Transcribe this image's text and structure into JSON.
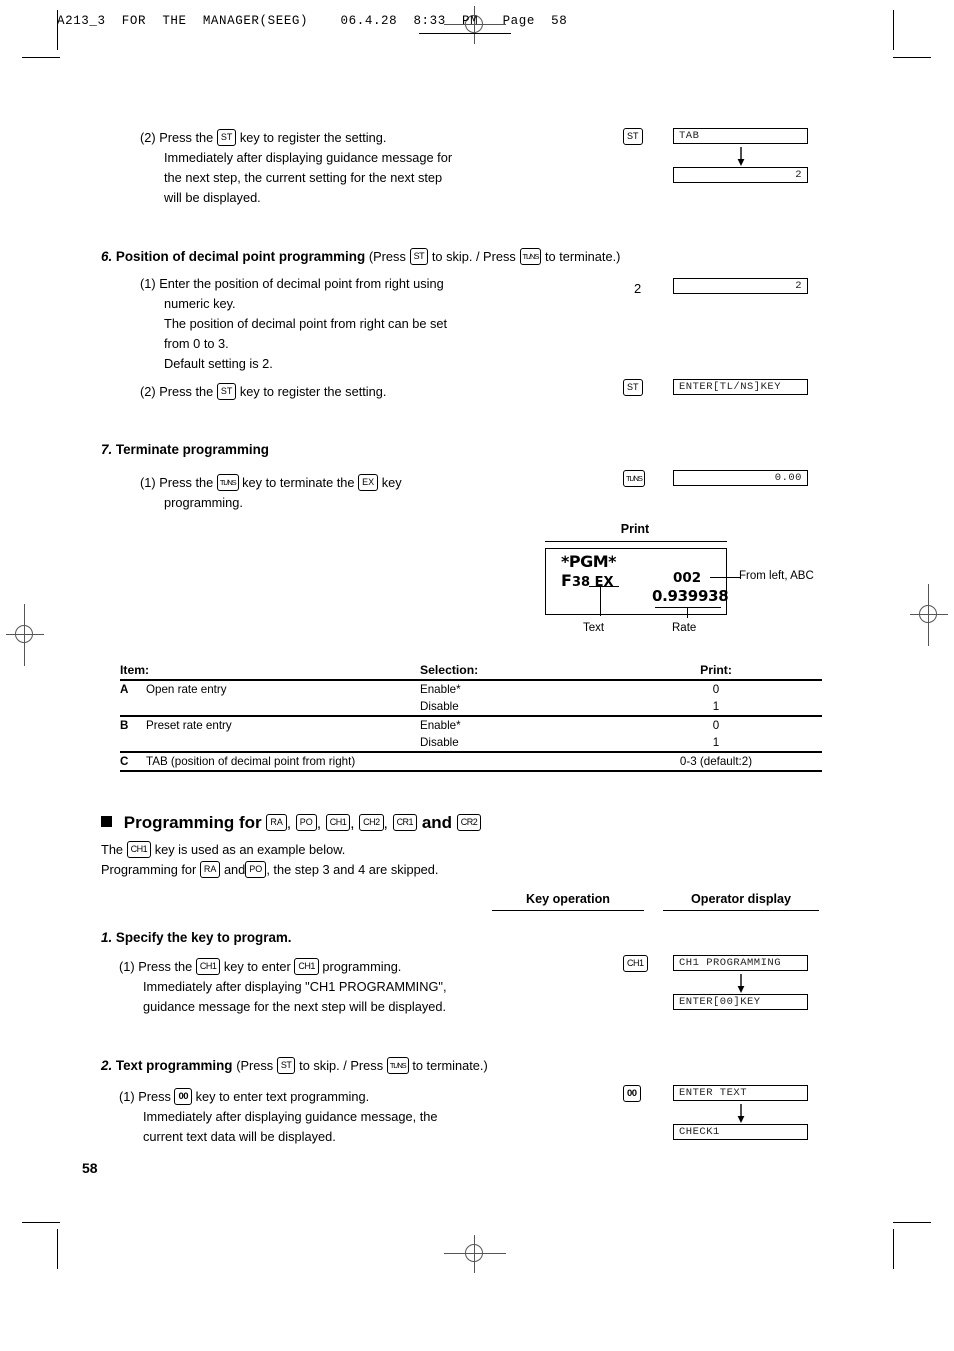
{
  "page": {
    "header_line": "A213_3  FOR  THE  MANAGER(SEEG)    06.4.28  8:33  PM   Page  58",
    "number": "58"
  },
  "step5": {
    "item2_prefix": "(2) Press the",
    "key_st": "ST",
    "item2_mid": "key to register the setting.",
    "item2_l2": "Immediately after displaying guidance message for",
    "item2_l3": "the next step, the current setting for the next step",
    "item2_l4": "will be displayed.",
    "display_1": "TAB",
    "display_2": "2"
  },
  "step6": {
    "num": "6.",
    "title": "Position of decimal point programming",
    "paren_open": "(Press",
    "key_st": "ST",
    "paren_mid": "to skip. / Press",
    "key_tlns": "TL/NS",
    "paren_close": "to terminate.)",
    "item1_l1": "(1) Enter the position of decimal point from right using",
    "item1_l2": "numeric key.",
    "item1_l3": "The position of decimal point from right can be set",
    "item1_l4": "from 0 to 3.",
    "item1_l5": "Default setting is 2.",
    "keyop_numeric": "2",
    "display_1": "2",
    "item2_prefix": "(2) Press the",
    "item2_mid": "key to register the setting.",
    "display_2": "ENTER[TL/NS]KEY"
  },
  "step7": {
    "num": "7.",
    "title": "Terminate programming",
    "item1_prefix": "(1) Press the",
    "key_tlns": "TL/NS",
    "item1_mid": "key to terminate the",
    "key_ex": "EX",
    "item1_suffix": "key",
    "item1_l2": "programming.",
    "display_1": "0.00"
  },
  "print_sample": {
    "title": "Print",
    "line1": "*PGM*",
    "line2_left": "F",
    "line2_num": "38",
    "line2_code": "EX",
    "line2_right": "002",
    "line3": "0.939938",
    "label_text": "Text",
    "label_rate": "Rate",
    "label_from_left": "From left, ABC"
  },
  "selection_table": {
    "headers": [
      "Item:",
      "Selection:",
      "Print:"
    ],
    "rows": [
      {
        "item": "A",
        "desc": "Open rate entry",
        "selection": "Enable*",
        "print": "0",
        "first": true
      },
      {
        "item": "",
        "desc": "",
        "selection": "Disable",
        "print": "1",
        "first": false
      },
      {
        "item": "B",
        "desc": "Preset rate entry",
        "selection": "Enable*",
        "print": "0",
        "first": true
      },
      {
        "item": "",
        "desc": "",
        "selection": "Disable",
        "print": "1",
        "first": false
      },
      {
        "item": "C",
        "desc": "TAB (position of decimal point from right)",
        "selection": "",
        "print": "0-3 (default:2)",
        "first": true
      }
    ]
  },
  "prog_section": {
    "heading_prefix": "Programming for",
    "heading_keys": [
      "RA",
      "PO",
      "CH1",
      "CH2",
      "CR1"
    ],
    "heading_and": "and",
    "heading_last_key": "CR2",
    "note1_prefix": "The",
    "note1_key": "CH1",
    "note1_suffix": "key is used as an example below.",
    "note2_prefix": "Programming for",
    "note2_key1": "RA",
    "note2_mid": "and",
    "note2_key2": "PO",
    "note2_suffix": ", the step 3 and 4 are skipped.",
    "col_key_operation": "Key operation",
    "col_operator_display": "Operator display"
  },
  "step1": {
    "num": "1.",
    "title": "Specify the key to program.",
    "item1_prefix": "(1) Press the",
    "key_ch1": "CH1",
    "item1_mid": "key to enter",
    "item1_suffix": "programming.",
    "item1_l2": "Immediately after displaying \"CH1 PROGRAMMING\",",
    "item1_l3": "guidance message for the next step will be displayed.",
    "display_1": "CH1 PROGRAMMING",
    "display_2": "ENTER[00]KEY"
  },
  "step2": {
    "num": "2.",
    "title": "Text programming",
    "paren_open": "(Press",
    "key_st": "ST",
    "paren_mid": "to skip. / Press",
    "key_tlns": "TL/NS",
    "paren_close": "to terminate.)",
    "item1_prefix": "(1) Press",
    "key_00": "00",
    "item1_suffix": "key to enter text programming.",
    "item1_l2": "Immediately after displaying guidance message, the",
    "item1_l3": "current text data will be displayed.",
    "display_1": "ENTER TEXT",
    "display_2": "CHECK1"
  }
}
